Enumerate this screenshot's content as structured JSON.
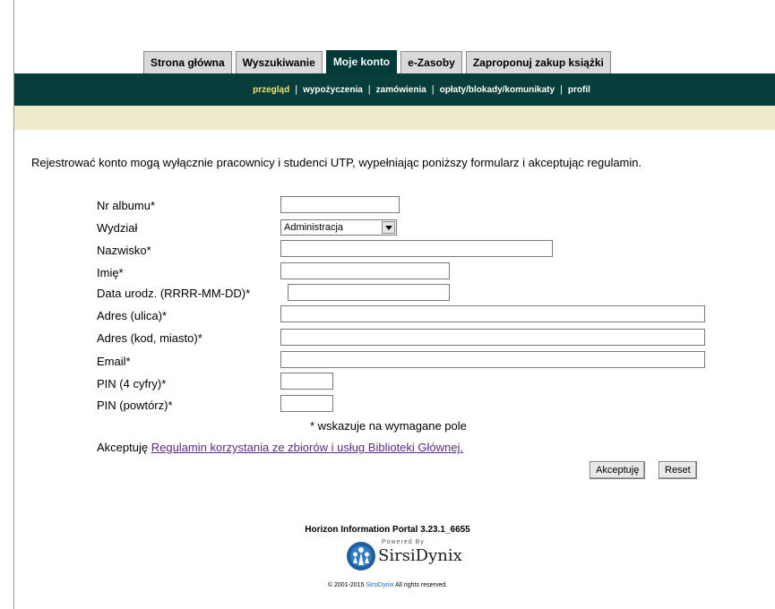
{
  "tabs": [
    {
      "label": "Strona główna"
    },
    {
      "label": "Wyszukiwanie"
    },
    {
      "label": "Moje konto",
      "active": true
    },
    {
      "label": "e-Zasoby"
    },
    {
      "label": "Zaproponuj zakup książki"
    }
  ],
  "subnav": [
    {
      "label": "przegląd",
      "active": true
    },
    {
      "label": "wypożyczenia"
    },
    {
      "label": "zamówienia"
    },
    {
      "label": "opłaty/blokady/komunikaty"
    },
    {
      "label": "profil"
    }
  ],
  "intro_text": "Rejestrować konto mogą wyłącznie pracownicy i studenci UTP, wypełniając poniższy formularz i akceptując regulamin.",
  "form": {
    "labels": {
      "album": "Nr albumu*",
      "faculty": "Wydział",
      "surname": "Nazwisko*",
      "firstname": "Imię*",
      "birthdate": "Data urodz. (RRRR-MM-DD)*",
      "street": "Adres (ulica)*",
      "city": "Adres (kod, miasto)*",
      "email": "Email*",
      "pin": "PIN (4 cyfry)*",
      "pin_repeat": "PIN (powtórz)*"
    },
    "values": {
      "album": "",
      "surname": "",
      "firstname": "",
      "birthdate": "",
      "street": "",
      "city": "",
      "email": "",
      "pin": "",
      "pin_repeat": ""
    },
    "faculty_selected": "Administracja",
    "required_note": "* wskazuje na wymagane pole",
    "accept_prefix": "Akceptuję",
    "accept_link": "Regulamin korzystania ze zbiorów i usług Biblioteki Głównej.",
    "accept_button": "Akceptuję",
    "reset_button": "Reset"
  },
  "footer": {
    "version": "Horizon Information Portal 3.23.1_6655",
    "powered_by": "Powered By",
    "brand": "SirsiDynix",
    "copyright_prefix": "© 2001-2015",
    "copyright_brand": "SirsiDynix",
    "copyright_suffix": "All rights reserved."
  },
  "colors": {
    "navbar": "#073d3a",
    "active_subnav": "#f4e26b",
    "cream_band": "#efebce",
    "link": "#5a2d82"
  }
}
